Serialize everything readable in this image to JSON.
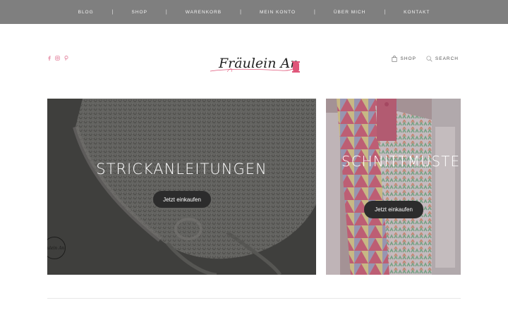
{
  "nav": {
    "items": [
      {
        "label": "BLOG"
      },
      {
        "label": "SHOP"
      },
      {
        "label": "WARENKORB"
      },
      {
        "label": "MEIN KONTO"
      },
      {
        "label": "ÜBER MICH"
      },
      {
        "label": "KONTAKT"
      }
    ],
    "separator": "|"
  },
  "header": {
    "logo_text": "Fräulein An",
    "social": [
      "facebook-icon",
      "instagram-icon",
      "pinterest-icon"
    ],
    "shop_label": "SHOP",
    "search_label": "SEARCH"
  },
  "cards": [
    {
      "title": "STRICKANLEITUNGEN",
      "button": "Jetzt einkaufen",
      "watermark": "äulein An"
    },
    {
      "title": "SCHNITTMUSTER",
      "button": "Jetzt einkaufen"
    }
  ],
  "colors": {
    "topbar": "#7f7f7f",
    "button": "#2c2c2c",
    "logo_accent": "#e0567a"
  }
}
